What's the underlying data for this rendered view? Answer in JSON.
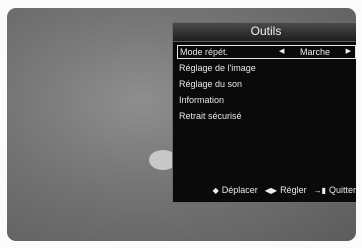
{
  "menu": {
    "title": "Outils",
    "items": [
      {
        "label": "Mode répét.",
        "value": "Marche",
        "selected": true
      },
      {
        "label": "Réglage de l'image"
      },
      {
        "label": "Réglage du son"
      },
      {
        "label": "Information"
      },
      {
        "label": "Retrait sécurisé"
      }
    ]
  },
  "footer": {
    "move_label": "Déplacer",
    "adjust_label": "Régler",
    "exit_label": "Quitter"
  },
  "icons": {
    "move": "up-down-arrows-icon",
    "adjust": "left-right-arrows-icon",
    "exit": "exit-icon",
    "left": "left-arrow-icon",
    "right": "right-arrow-icon"
  }
}
